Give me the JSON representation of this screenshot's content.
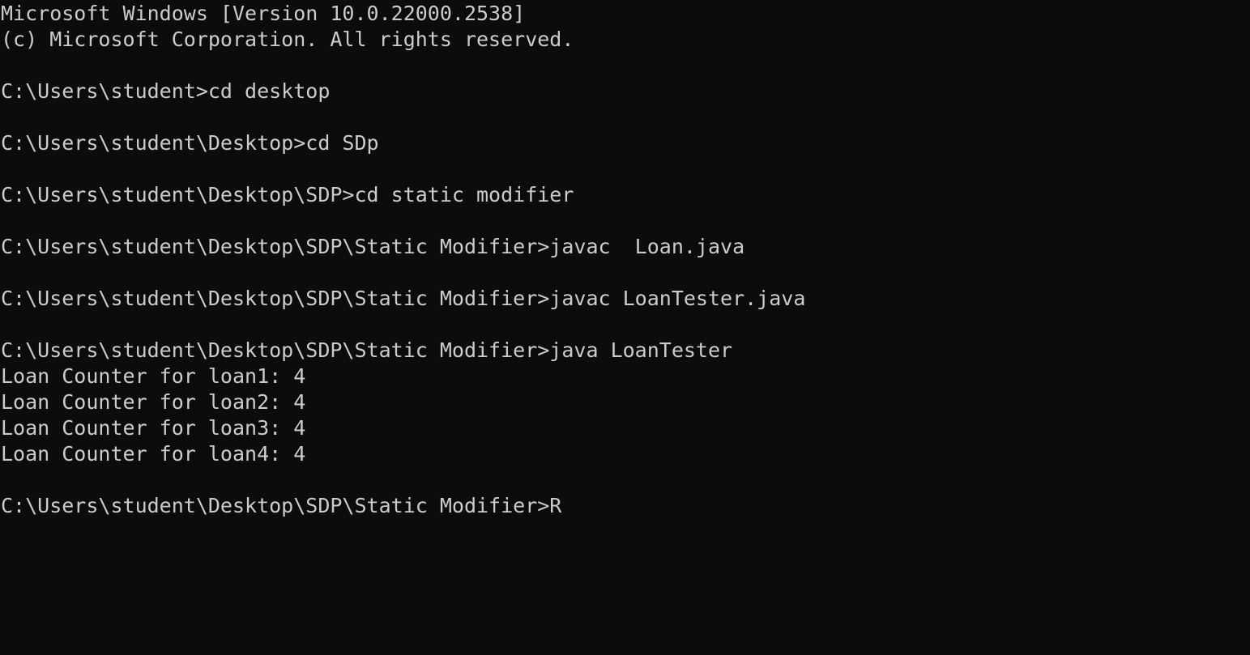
{
  "window": {
    "background": "#0c0c0c",
    "foreground": "#cccccc"
  },
  "terminal": {
    "lines": [
      "Microsoft Windows [Version 10.0.22000.2538]",
      "(c) Microsoft Corporation. All rights reserved.",
      "",
      "C:\\Users\\student>cd desktop",
      "",
      "C:\\Users\\student\\Desktop>cd SDp",
      "",
      "C:\\Users\\student\\Desktop\\SDP>cd static modifier",
      "",
      "C:\\Users\\student\\Desktop\\SDP\\Static Modifier>javac  Loan.java",
      "",
      "C:\\Users\\student\\Desktop\\SDP\\Static Modifier>javac LoanTester.java",
      "",
      "C:\\Users\\student\\Desktop\\SDP\\Static Modifier>java LoanTester",
      "Loan Counter for loan1: 4",
      "Loan Counter for loan2: 4",
      "Loan Counter for loan3: 4",
      "Loan Counter for loan4: 4",
      "",
      "C:\\Users\\student\\Desktop\\SDP\\Static Modifier>R"
    ]
  }
}
